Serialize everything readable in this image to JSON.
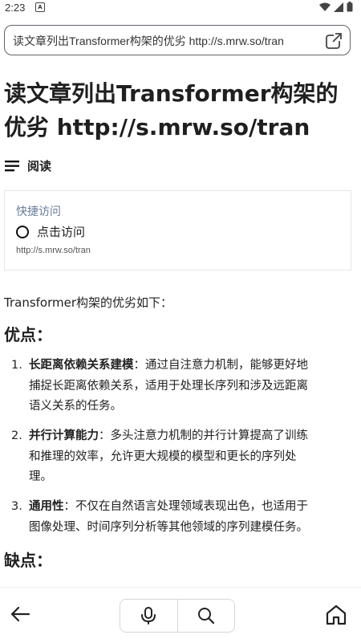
{
  "status": {
    "time": "2:23",
    "notif_icon": "A"
  },
  "urlbar": {
    "text": "读文章列出Transformer构架的优劣 http://s.mrw.so/tran"
  },
  "page": {
    "title_line1": "读文章列出Transformer构架的",
    "title_line2": "优劣 http://s.mrw.so/tran",
    "read_label": "阅读"
  },
  "quick_access": {
    "title": "快捷访问",
    "option_label": "点击访问",
    "url": "http://s.mrw.so/tran"
  },
  "content": {
    "intro": "Transformer构架的优劣如下：",
    "advantages_heading": "优点：",
    "disadvantages_heading": "缺点：",
    "advantages": [
      {
        "num": "1.",
        "term": "长距离依赖关系建模",
        "line1": "：通过自注意力机制，能够更好地",
        "line2": "捕捉长距离依赖关系，适用于处理长序列和涉及远距离",
        "line3": "语义关系的任务。"
      },
      {
        "num": "2.",
        "term": "并行计算能力",
        "line1": "：多头注意力机制的并行计算提高了训练",
        "line2": "和推理的效率，允许更大规模的模型和更长的序列处",
        "line3": "理。"
      },
      {
        "num": "3.",
        "term": "通用性",
        "line1": "：不仅在自然语言处理领域表现出色，也适用于",
        "line2": "图像处理、时间序列分析等其他领域的序列建模任务。"
      }
    ]
  },
  "nav": {
    "back_icon": "arrow-left-icon",
    "mic_icon": "microphone-icon",
    "search_icon": "search-icon",
    "home_icon": "home-icon"
  }
}
